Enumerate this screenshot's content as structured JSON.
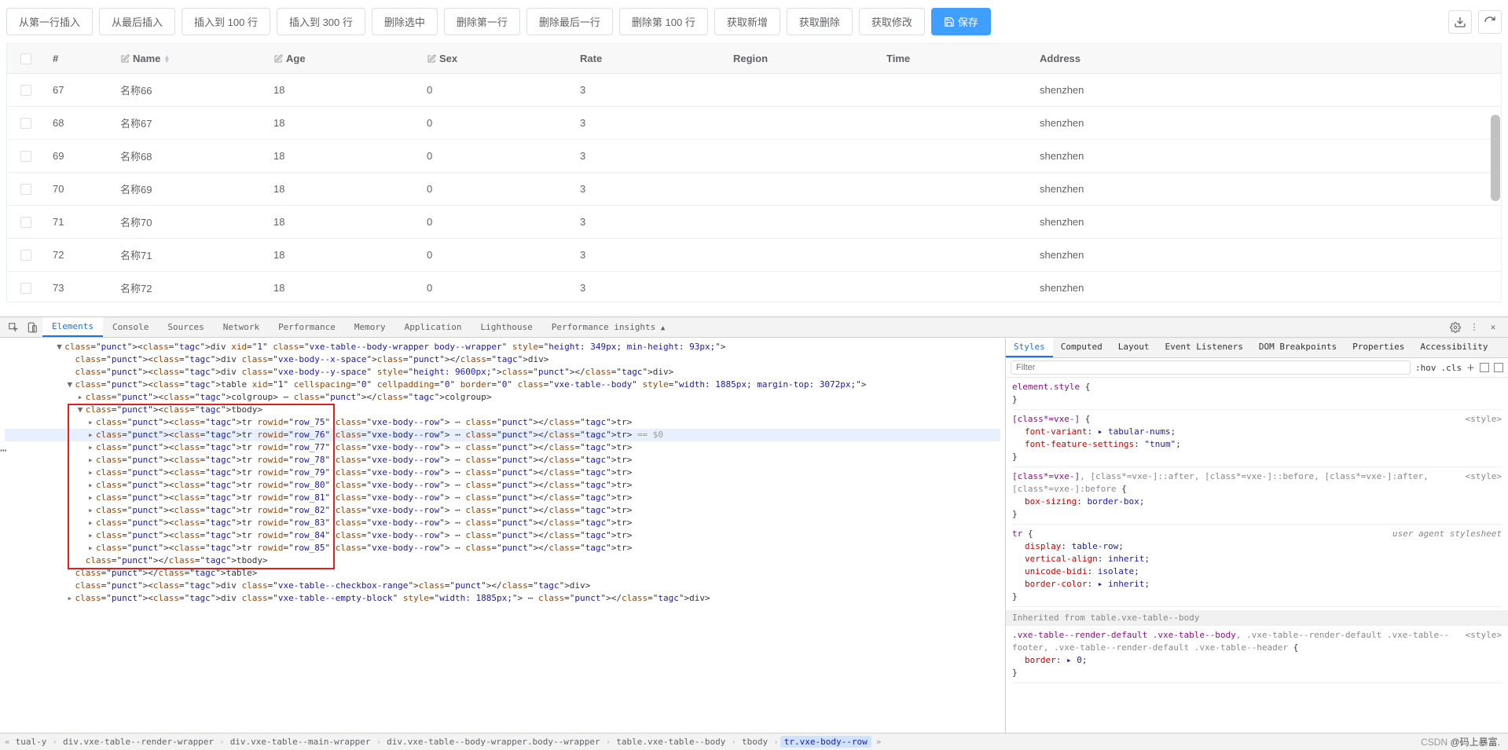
{
  "toolbar": {
    "btns": [
      "从第一行插入",
      "从最后插入",
      "插入到 100 行",
      "插入到 300 行",
      "删除选中",
      "删除第一行",
      "删除最后一行",
      "删除第 100 行",
      "获取新增",
      "获取删除",
      "获取修改"
    ],
    "save": "保存"
  },
  "table": {
    "headers": {
      "hash": "#",
      "name": "Name",
      "age": "Age",
      "sex": "Sex",
      "rate": "Rate",
      "region": "Region",
      "time": "Time",
      "address": "Address"
    },
    "rows": [
      {
        "idx": "67",
        "name": "名称66",
        "age": "18",
        "sex": "0",
        "rate": "3",
        "region": "",
        "time": "",
        "address": "shenzhen"
      },
      {
        "idx": "68",
        "name": "名称67",
        "age": "18",
        "sex": "0",
        "rate": "3",
        "region": "",
        "time": "",
        "address": "shenzhen"
      },
      {
        "idx": "69",
        "name": "名称68",
        "age": "18",
        "sex": "0",
        "rate": "3",
        "region": "",
        "time": "",
        "address": "shenzhen"
      },
      {
        "idx": "70",
        "name": "名称69",
        "age": "18",
        "sex": "0",
        "rate": "3",
        "region": "",
        "time": "",
        "address": "shenzhen"
      },
      {
        "idx": "71",
        "name": "名称70",
        "age": "18",
        "sex": "0",
        "rate": "3",
        "region": "",
        "time": "",
        "address": "shenzhen"
      },
      {
        "idx": "72",
        "name": "名称71",
        "age": "18",
        "sex": "0",
        "rate": "3",
        "region": "",
        "time": "",
        "address": "shenzhen"
      },
      {
        "idx": "73",
        "name": "名称72",
        "age": "18",
        "sex": "0",
        "rate": "3",
        "region": "",
        "time": "",
        "address": "shenzhen"
      }
    ]
  },
  "devtools": {
    "tabs": [
      "Elements",
      "Console",
      "Sources",
      "Network",
      "Performance",
      "Memory",
      "Application",
      "Lighthouse",
      "Performance insights"
    ],
    "side_tabs": [
      "Styles",
      "Computed",
      "Layout",
      "Event Listeners",
      "DOM Breakpoints",
      "Properties",
      "Accessibility"
    ],
    "filter_placeholder": "Filter",
    "hov": ":hov",
    "cls": ".cls",
    "dom_lines": [
      {
        "indent": 3,
        "pre": "▼",
        "html": "<div xid=\"1\" class=\"vxe-table--body-wrapper body--wrapper\" style=\"height: 349px; min-height: 93px;\">"
      },
      {
        "indent": 4,
        "pre": "",
        "html": "<div class=\"vxe-body--x-space\"></div>"
      },
      {
        "indent": 4,
        "pre": "",
        "html": "<div class=\"vxe-body--y-space\" style=\"height: 9600px;\"></div>"
      },
      {
        "indent": 4,
        "pre": "▼",
        "html": "<table xid=\"1\" cellspacing=\"0\" cellpadding=\"0\" border=\"0\" class=\"vxe-table--body\" style=\"width: 1885px; margin-top: 3072px;\">"
      },
      {
        "indent": 5,
        "pre": "▸",
        "html": "<colgroup> ⋯ </colgroup>"
      },
      {
        "indent": 5,
        "pre": "▼",
        "html": "<tbody>"
      },
      {
        "indent": 6,
        "pre": "▸",
        "html": "<tr rowid=\"row_75\" class=\"vxe-body--row\"> ⋯ </tr>"
      },
      {
        "indent": 6,
        "pre": "▸",
        "html": "<tr rowid=\"row_76\" class=\"vxe-body--row\"> ⋯ </tr>",
        "hl": true,
        "eq": "== $0"
      },
      {
        "indent": 6,
        "pre": "▸",
        "html": "<tr rowid=\"row_77\" class=\"vxe-body--row\"> ⋯ </tr>"
      },
      {
        "indent": 6,
        "pre": "▸",
        "html": "<tr rowid=\"row_78\" class=\"vxe-body--row\"> ⋯ </tr>"
      },
      {
        "indent": 6,
        "pre": "▸",
        "html": "<tr rowid=\"row_79\" class=\"vxe-body--row\"> ⋯ </tr>"
      },
      {
        "indent": 6,
        "pre": "▸",
        "html": "<tr rowid=\"row_80\" class=\"vxe-body--row\"> ⋯ </tr>"
      },
      {
        "indent": 6,
        "pre": "▸",
        "html": "<tr rowid=\"row_81\" class=\"vxe-body--row\"> ⋯ </tr>"
      },
      {
        "indent": 6,
        "pre": "▸",
        "html": "<tr rowid=\"row_82\" class=\"vxe-body--row\"> ⋯ </tr>"
      },
      {
        "indent": 6,
        "pre": "▸",
        "html": "<tr rowid=\"row_83\" class=\"vxe-body--row\"> ⋯ </tr>"
      },
      {
        "indent": 6,
        "pre": "▸",
        "html": "<tr rowid=\"row_84\" class=\"vxe-body--row\"> ⋯ </tr>"
      },
      {
        "indent": 6,
        "pre": "▸",
        "html": "<tr rowid=\"row_85\" class=\"vxe-body--row\"> ⋯ </tr>"
      },
      {
        "indent": 5,
        "pre": "",
        "html": "</tbody>"
      },
      {
        "indent": 4,
        "pre": "",
        "html": "</table>"
      },
      {
        "indent": 4,
        "pre": "",
        "html": "<div class=\"vxe-table--checkbox-range\"></div>"
      },
      {
        "indent": 4,
        "pre": "▸",
        "html": "<div class=\"vxe-table--empty-block\" style=\"width: 1885px;\"> ⋯ </div>"
      }
    ],
    "styles_rules": [
      {
        "sel": "element.style",
        "body": []
      },
      {
        "sel": "[class*=vxe-]",
        "src": "<style>",
        "body": [
          [
            "font-variant",
            "▸ tabular-nums"
          ],
          [
            "font-feature-settings",
            "\"tnum\""
          ]
        ]
      },
      {
        "sel": "[class*=vxe-], [class*=vxe-]::after, [class*=vxe-]::before, [class*=vxe-]:after, [class*=vxe-]:before",
        "src": "<style>",
        "body": [
          [
            "box-sizing",
            "border-box"
          ]
        ]
      },
      {
        "sel": "tr",
        "ua": "user agent stylesheet",
        "body": [
          [
            "display",
            "table-row"
          ],
          [
            "vertical-align",
            "inherit"
          ],
          [
            "unicode-bidi",
            "isolate"
          ],
          [
            "border-color",
            "▸ inherit"
          ]
        ]
      },
      {
        "inherit": "Inherited from table.vxe-table--body"
      },
      {
        "sel": ".vxe-table--render-default .vxe-table--body, .vxe-table--render-default .vxe-table--footer, .vxe-table--render-default .vxe-table--header",
        "src": "<style>",
        "body": [
          [
            "border",
            "▸ 0"
          ]
        ]
      }
    ],
    "crumbs": [
      "tual-y",
      "div.vxe-table--render-wrapper",
      "div.vxe-table--main-wrapper",
      "div.vxe-table--body-wrapper.body--wrapper",
      "table.vxe-table--body",
      "tbody",
      "tr.vxe-body--row"
    ]
  },
  "watermark": {
    "a": "CSDN ",
    "b": "@码上暴富."
  }
}
